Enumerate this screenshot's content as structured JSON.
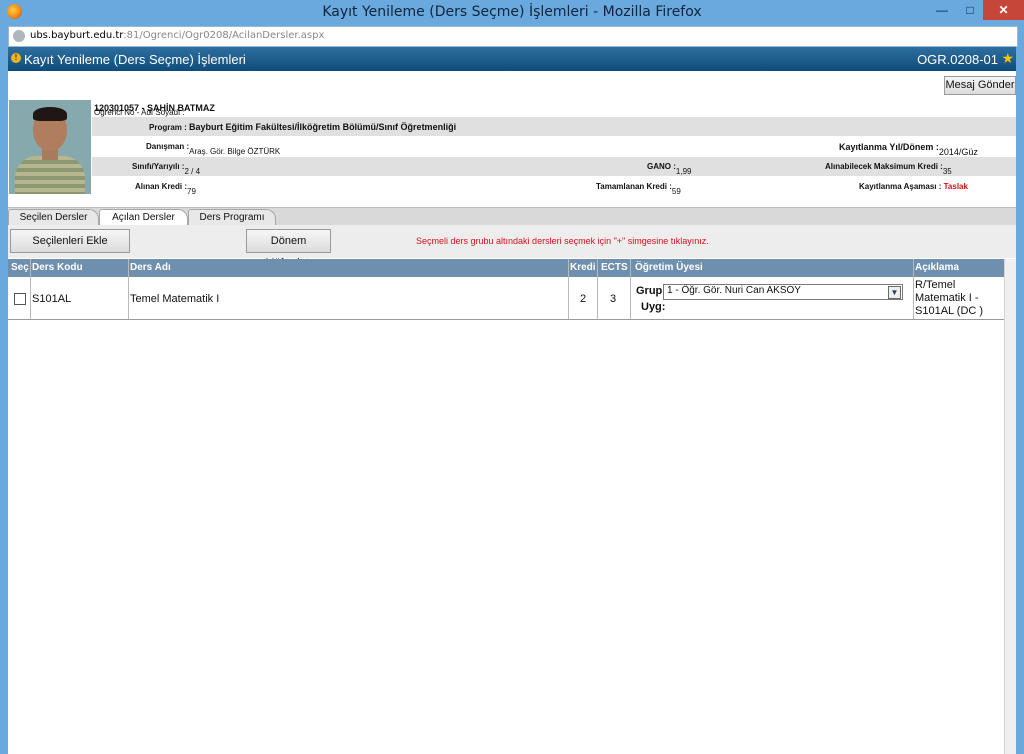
{
  "window": {
    "title": "Kayıt Yenileme (Ders Seçme) İşlemleri - Mozilla Firefox"
  },
  "browser": {
    "url_host": "ubs.bayburt.edu.tr",
    "url_rest": ":81/Ogrenci/Ogr0208/AcilanDersler.aspx"
  },
  "page": {
    "title": "Kayıt Yenileme (Ders Seçme) İşlemleri",
    "code": "OGR.0208-01",
    "mesaj_button": "Mesaj Gönder"
  },
  "student": {
    "no_label": "Öğrenci No - Adı Soyadı :",
    "no_value": "120301057 - ŞAHİN BATMAZ",
    "program_label": "Program :",
    "program_value": "Bayburt Eğitim Fakültesi/İlköğretim Bölümü/Sınıf Öğretmenliği",
    "danisman_label": "Danışman :",
    "danisman_value": "Araş. Gör. Bilge ÖZTÜRK",
    "kayit_label": "Kayıtlanma Yıl/Dönem :",
    "kayit_value": "2014/Güz",
    "sinif_label": "Sınıfı/Yarıyılı :",
    "sinif_value": "2 / 4",
    "gano_label": "GANO :",
    "gano_value": "1,99",
    "max_kredi_label": "Alınabilecek Maksimum Kredi :",
    "max_kredi_value": "35",
    "alinan_label": "Alınan Kredi :",
    "alinan_value": "79",
    "tamam_label": "Tamamlanan Kredi :",
    "tamam_value": "59",
    "asama_label": "Kayıtlanma Aşaması :",
    "asama_value": "Taslak"
  },
  "tabs": [
    {
      "label": "Seçilen Dersler"
    },
    {
      "label": "Açılan Dersler"
    },
    {
      "label": "Ders Programı"
    }
  ],
  "toolbar": {
    "ekle_label": "Seçilenleri Ekle",
    "mufredat_label": "Dönem Müfredatı",
    "hint": "Seçmeli ders grubu altındaki dersleri seçmek için \"+\" simgesine tıklayınız."
  },
  "table": {
    "headers": [
      "Seç",
      "Ders Kodu",
      "Ders Adı",
      "Kredi",
      "ECTS",
      "Öğretim Üyesi",
      "Açıklama"
    ],
    "rows": [
      {
        "kod": "S101AL",
        "ad": "Temel Matematik I",
        "kredi": "2",
        "ects": "3",
        "grup_label": "Grup:",
        "grup_value": "1 - Öğr. Gör. Nuri Can AKSOY",
        "uyg_label": "Uyg:",
        "aciklama": [
          "R/Temel",
          "Matematik I -",
          "S101AL (DC )"
        ]
      }
    ]
  },
  "colors": {
    "accent": "#0f4c7a",
    "header": "#6f8fae",
    "warning": "#d6101b"
  }
}
